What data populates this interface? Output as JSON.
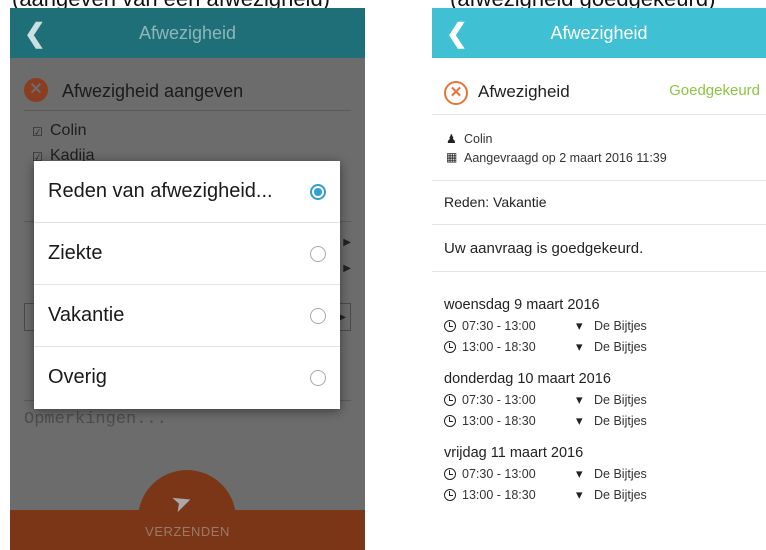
{
  "caption": {
    "left": "(aangeven van een afwezigheid)",
    "right": "(afwezigheid goedgekeurd)"
  },
  "left_screen": {
    "header": {
      "back_icon": "chevron-left-icon",
      "title": "Afwezigheid"
    },
    "heading": "Afwezigheid aangeven",
    "children": [
      "Colin",
      "Kadija"
    ],
    "remarks_placeholder": "Opmerkingen...",
    "send_label": "VERZENDEN",
    "dialog": {
      "options": [
        {
          "label": "Reden van afwezigheid...",
          "selected": true
        },
        {
          "label": "Ziekte",
          "selected": false
        },
        {
          "label": "Vakantie",
          "selected": false
        },
        {
          "label": "Overig",
          "selected": false
        }
      ]
    },
    "colors": {
      "header": "#1f6f78",
      "footer": "#7a3616",
      "radio_selected": "#2e9fd4"
    }
  },
  "right_screen": {
    "header": {
      "back_icon": "chevron-left-icon",
      "title": "Afwezigheid"
    },
    "heading": "Afwezigheid",
    "status": "Goedgekeurd",
    "child": "Colin",
    "requested": "Aangevraagd op 2 maart 2016 11:39",
    "reason": "Reden: Vakantie",
    "message": "Uw aanvraag is goedgekeurd.",
    "days": [
      {
        "date": "woensdag 9 maart 2016",
        "slots": [
          {
            "time": "07:30 - 13:00",
            "location": "De Bijtjes"
          },
          {
            "time": "13:00 - 18:30",
            "location": "De Bijtjes"
          }
        ]
      },
      {
        "date": "donderdag 10 maart 2016",
        "slots": [
          {
            "time": "07:30 - 13:00",
            "location": "De Bijtjes"
          },
          {
            "time": "13:00 - 18:30",
            "location": "De Bijtjes"
          }
        ]
      },
      {
        "date": "vrijdag 11 maart 2016",
        "slots": [
          {
            "time": "07:30 - 13:00",
            "location": "De Bijtjes"
          },
          {
            "time": "13:00 - 18:30",
            "location": "De Bijtjes"
          }
        ]
      }
    ],
    "colors": {
      "header": "#3fc1d3",
      "status": "#8cc63f",
      "cancel_icon": "#e8733a"
    }
  }
}
